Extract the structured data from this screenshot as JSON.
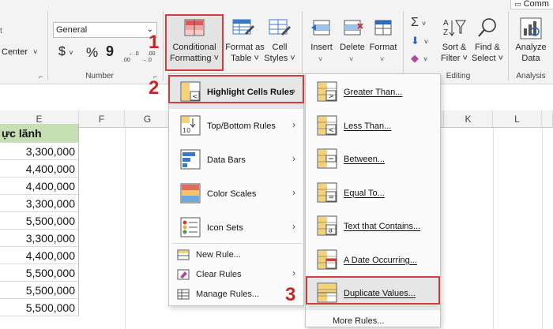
{
  "ribbon": {
    "top_right_label": "Comm",
    "alignment_partial": "Center",
    "number_format": "General",
    "number_group_label": "Number",
    "currency_symbol": "$",
    "percent_symbol": "%",
    "comma_symbol": "9",
    "dec_increase": "←.0\n.00",
    "dec_decrease": ".00\n→.0",
    "conditional_formatting": [
      "Conditional",
      "Formatting ˅"
    ],
    "format_as_table": [
      "Format as",
      "Table ˅"
    ],
    "cell_styles": [
      "Cell",
      "Styles ˅"
    ],
    "insert": "Insert",
    "delete": "Delete",
    "format": "Format",
    "sort_filter": [
      "Sort &",
      "Filter ˅"
    ],
    "find_select": [
      "Find &",
      "Select ˅"
    ],
    "analyze_data": [
      "Analyze",
      "Data"
    ],
    "editing_group_label": "Editing",
    "analysis_group_label": "Analysis"
  },
  "sheet": {
    "col_headers": [
      "E",
      "F",
      "G",
      "K",
      "L"
    ],
    "header_cell": "ực lãnh",
    "values": [
      "3,300,000",
      "4,400,000",
      "4,400,000",
      "3,300,000",
      "5,500,000",
      "3,300,000",
      "4,400,000",
      "5,500,000",
      "5,500,000",
      "5,500,000"
    ],
    "header_fill": "#c6e0b4"
  },
  "main_menu": {
    "items": [
      "Highlight Cells Rules",
      "Top/Bottom Rules",
      "Data Bars",
      "Color Scales",
      "Icon Sets"
    ],
    "small_items": [
      "New Rule...",
      "Clear Rules",
      "Manage Rules..."
    ]
  },
  "sub_menu": {
    "items": [
      "Greater Than...",
      "Less Than...",
      "Between...",
      "Equal To...",
      "Text that Contains...",
      "A Date Occurring...",
      "Duplicate Values..."
    ],
    "more": "More Rules..."
  },
  "steps": [
    "1",
    "2",
    "3"
  ],
  "colors": {
    "highlight_red": "#d33c3c",
    "step_red": "#c62828",
    "hover_fill": "#e6e6e6"
  }
}
